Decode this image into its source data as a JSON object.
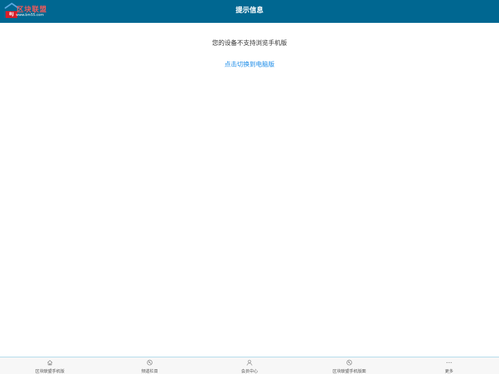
{
  "header": {
    "logo": {
      "badge": "BJ",
      "title": "区块联盟",
      "url": "www.bm55.com"
    },
    "title": "提示信息"
  },
  "content": {
    "message": "您的设备不支持浏览手机版",
    "switch_link": "点击切换到电脑版"
  },
  "bottom_nav": {
    "items": [
      {
        "label": "区块联盟手机版",
        "icon": "home-icon"
      },
      {
        "label": "频道栏目",
        "icon": "compass-icon"
      },
      {
        "label": "会员中心",
        "icon": "user-icon"
      },
      {
        "label": "区块联盟手机版面",
        "icon": "compass-icon"
      },
      {
        "label": "更多",
        "icon": "more-icon"
      }
    ]
  },
  "colors": {
    "header_bg": "#006791",
    "link": "#1a8be8",
    "logo_red": "#d81e2a"
  }
}
